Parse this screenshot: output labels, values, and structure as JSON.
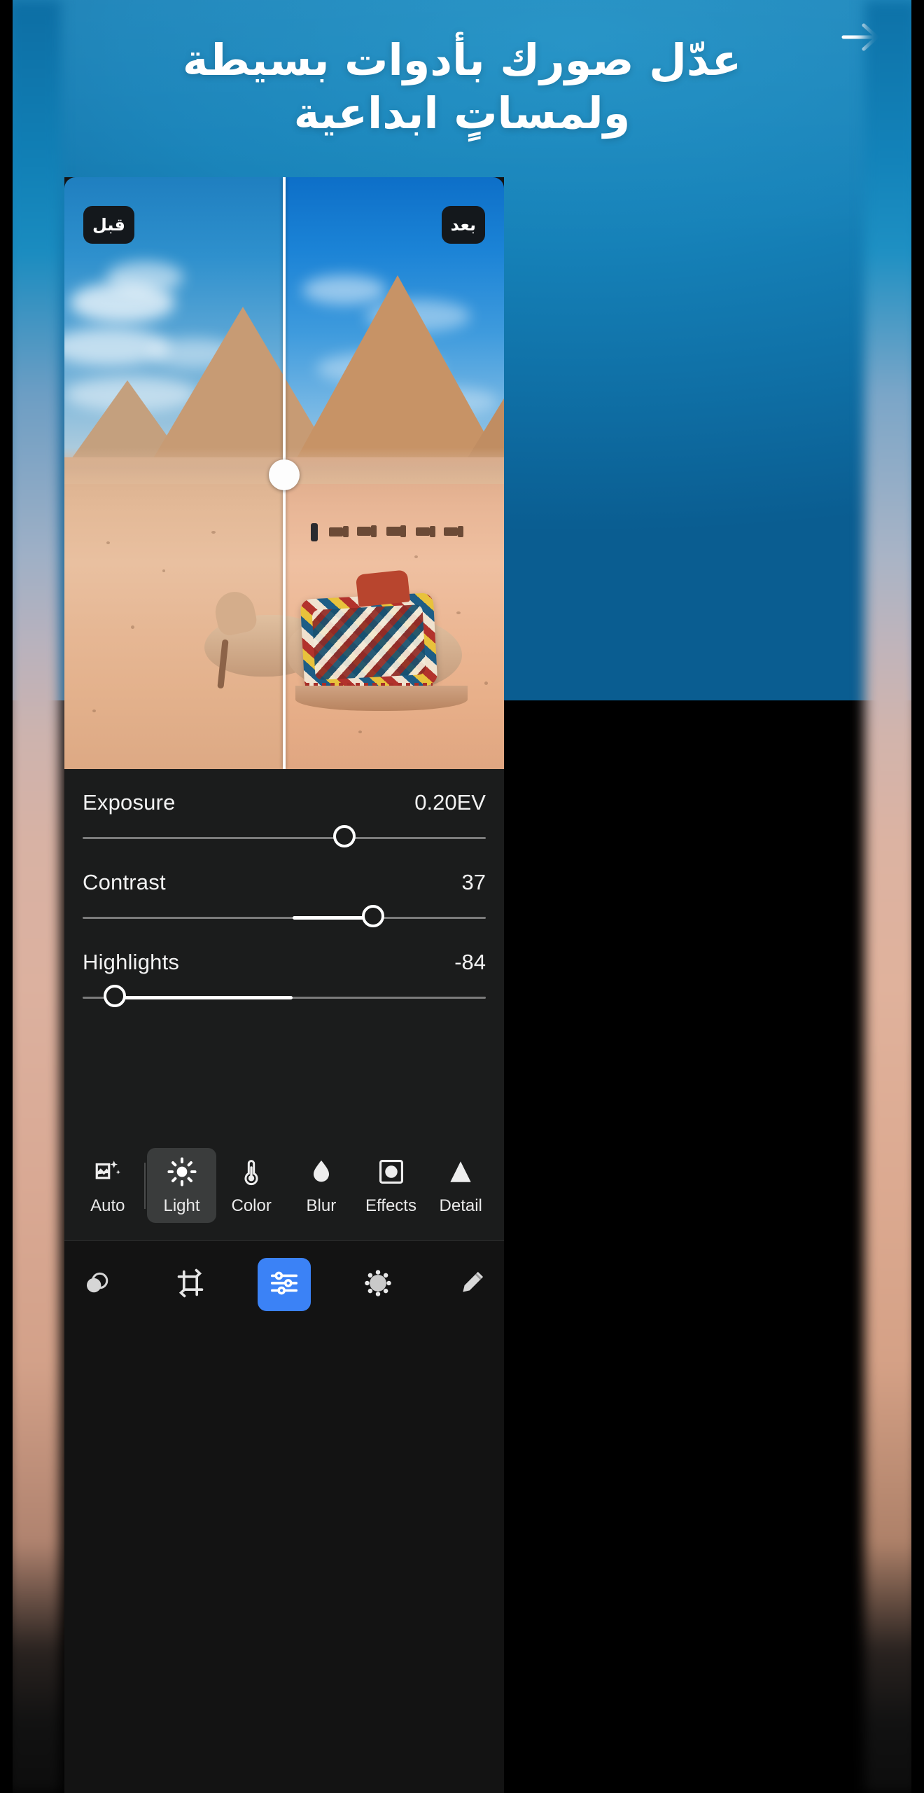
{
  "banner": {
    "headline": "عدّل صورك بأدوات بسيطة ولمساتٍ ابداعية",
    "next_arrow_icon": "arrow-right-icon",
    "bg_color": "#1682b9"
  },
  "compare": {
    "before_label": "قبل",
    "after_label": "بعد",
    "divider_handle_icon": "compare-handle-icon",
    "divider_position_pct": 50
  },
  "adjust_panel": {
    "accent_color": "#3b82f6",
    "panel_bg": "#1b1c1c",
    "sliders": [
      {
        "name": "Exposure",
        "value": "0.20EV",
        "fill_pct": 0,
        "thumb_pct": 65
      },
      {
        "name": "Contrast",
        "value": "37",
        "fill_pct": 72,
        "thumb_pct": 72,
        "fill_from_pct": 52
      },
      {
        "name": "Highlights",
        "value": "-84",
        "fill_pct": 8,
        "thumb_pct": 8
      }
    ]
  },
  "tools": {
    "items": [
      {
        "label": "Auto",
        "icon": "auto-enhance-icon",
        "active": false
      },
      {
        "label": "Light",
        "icon": "sun-icon",
        "active": true
      },
      {
        "label": "Color",
        "icon": "thermometer-icon",
        "active": false
      },
      {
        "label": "Blur",
        "icon": "droplet-icon",
        "active": false
      },
      {
        "label": "Effects",
        "icon": "effects-frame-icon",
        "active": false
      },
      {
        "label": "Detail",
        "icon": "triangle-detail-icon",
        "active": false
      }
    ]
  },
  "bottom_nav": {
    "items": [
      {
        "name": "presets",
        "icon": "overlapping-circles-icon",
        "active": false
      },
      {
        "name": "crop",
        "icon": "crop-rotate-icon",
        "active": false
      },
      {
        "name": "adjust",
        "icon": "sliders-icon",
        "active": true
      },
      {
        "name": "effects",
        "icon": "dotted-circle-icon",
        "active": false
      },
      {
        "name": "retouch",
        "icon": "healing-brush-icon",
        "active": false
      }
    ]
  }
}
